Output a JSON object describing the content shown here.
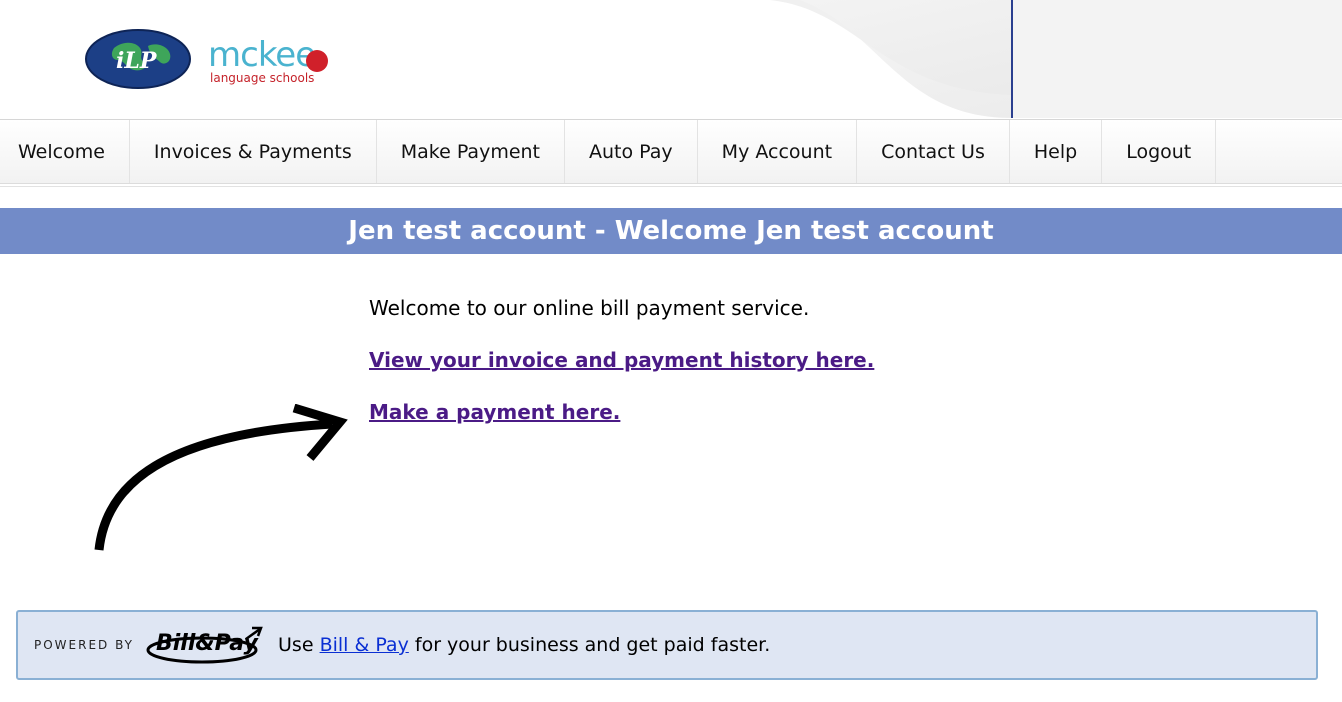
{
  "header": {
    "logo_ilp_text": "iLP",
    "logo_mckee_word": "mckee",
    "logo_mckee_sub": "language schools"
  },
  "nav": {
    "items": [
      {
        "label": "Welcome"
      },
      {
        "label": "Invoices & Payments"
      },
      {
        "label": "Make Payment"
      },
      {
        "label": "Auto Pay"
      },
      {
        "label": "My Account"
      },
      {
        "label": "Contact Us"
      },
      {
        "label": "Help"
      },
      {
        "label": "Logout"
      }
    ]
  },
  "title_bar": {
    "title": "Jen test account - Welcome Jen test account"
  },
  "content": {
    "welcome": "Welcome to our online bill payment service.",
    "history_link": "View your invoice and payment history here.",
    "payment_link": "Make a payment here."
  },
  "footer": {
    "powered_by": "POWERED BY",
    "logo_text": "Bill&Pay",
    "text_prefix": "Use",
    "link_label": "Bill & Pay",
    "text_suffix": "for your business and get paid faster."
  },
  "colors": {
    "title_bar": "#728bc8",
    "link": "#4b1b86",
    "footer_bg": "#dfe6f3",
    "footer_border": "#8ab0d4",
    "footer_link": "#0a2fd3",
    "header_divider": "#2a3f8f"
  },
  "icons": {
    "arrow": "curved-arrow-icon",
    "globe": "globe-icon"
  }
}
